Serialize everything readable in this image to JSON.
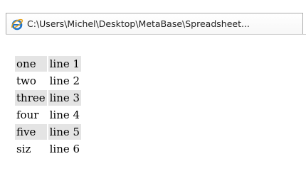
{
  "browser": {
    "tab_title": "C:\\Users\\Michel\\Desktop\\MetaBase\\Spreadsheet...",
    "icon": "internet-explorer-icon"
  },
  "table": {
    "rows": [
      {
        "name": "one",
        "value": "line 1",
        "shaded": true
      },
      {
        "name": "two",
        "value": "line 2",
        "shaded": false
      },
      {
        "name": "three",
        "value": "line 3",
        "shaded": true
      },
      {
        "name": "four",
        "value": "line 4",
        "shaded": false
      },
      {
        "name": "five",
        "value": "line 5",
        "shaded": true
      },
      {
        "name": "siz",
        "value": "line 6",
        "shaded": false
      }
    ]
  }
}
